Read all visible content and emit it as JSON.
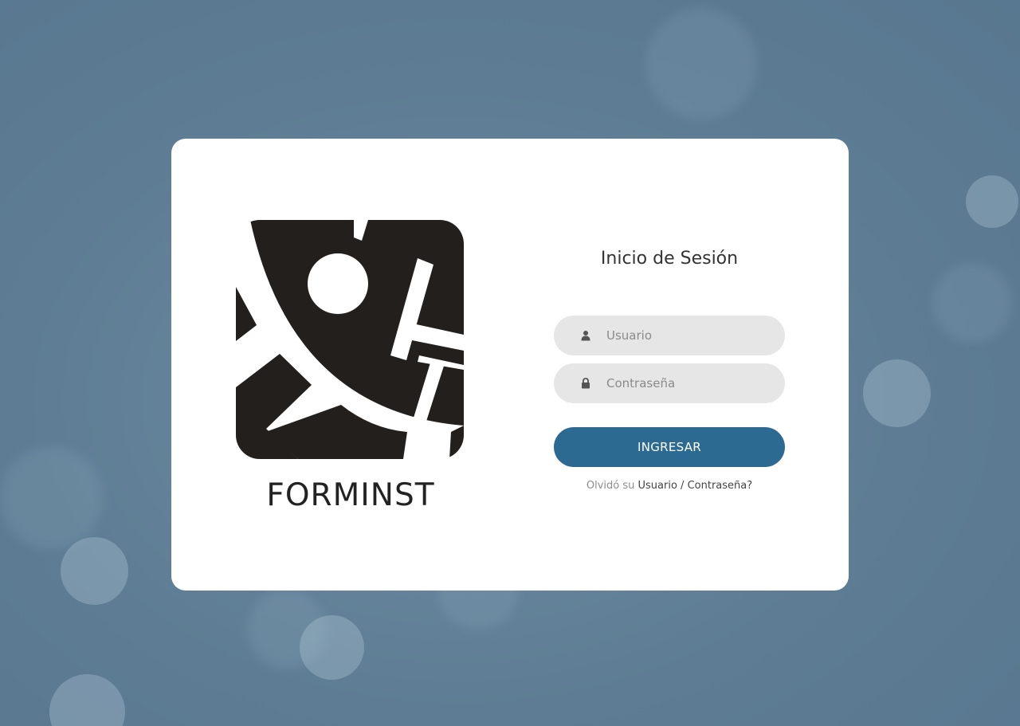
{
  "brand": {
    "name": "FORMINST"
  },
  "login": {
    "title": "Inicio de Sesión",
    "username_placeholder": "Usuario",
    "password_placeholder": "Contraseña",
    "submit_label": "INGRESAR",
    "forgot_prefix": "Olvidó su",
    "forgot_user_link": "Usuario",
    "forgot_separator": "/",
    "forgot_password_link": "Contraseña?"
  },
  "icons": {
    "username": "user-icon",
    "password": "lock-icon"
  },
  "colors": {
    "background": "#5e7d94",
    "card": "#ffffff",
    "field": "#e6e6e6",
    "button": "#2d6a91",
    "logo": "#231f1c"
  }
}
